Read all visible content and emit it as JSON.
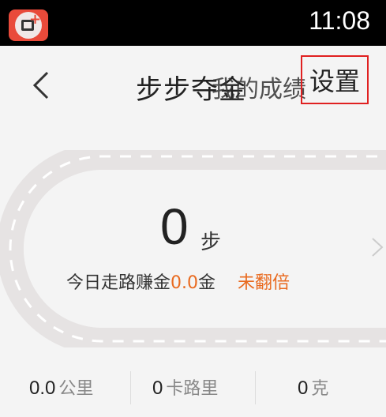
{
  "status_bar": {
    "time": "11:08"
  },
  "header": {
    "title": "步步夺金",
    "title_overlay": "我的成绩",
    "settings_label": "设置"
  },
  "steps": {
    "count": "0",
    "unit": "步"
  },
  "earnings": {
    "prefix": "今日走路赚金",
    "value": "0.0",
    "unit": "金",
    "double_status": "未翻倍"
  },
  "stats": [
    {
      "value": "0.0",
      "unit": "公里"
    },
    {
      "value": "0",
      "unit": "卡路里"
    },
    {
      "value": "0",
      "unit": "克"
    }
  ],
  "colors": {
    "accent": "#e96a1f",
    "highlight_border": "#e02020"
  }
}
